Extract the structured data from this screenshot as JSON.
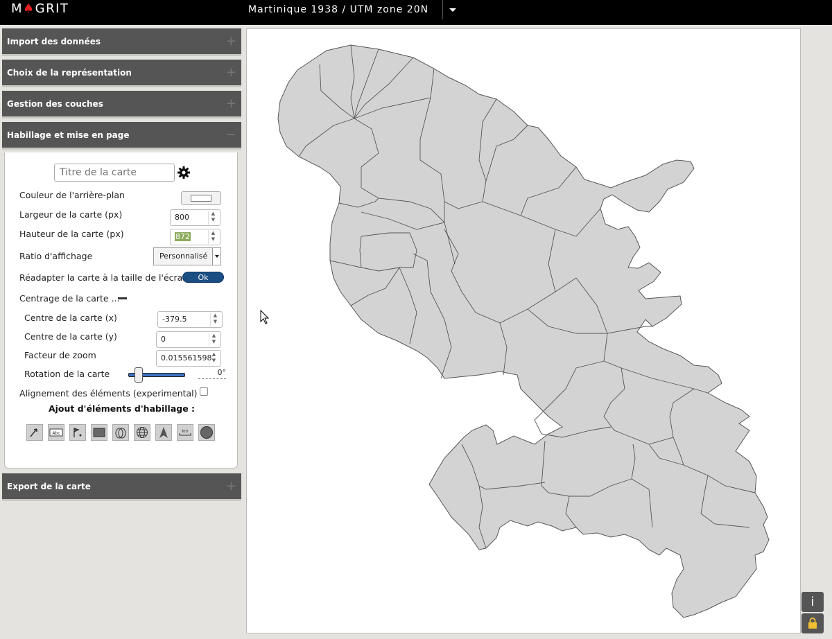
{
  "app": {
    "logo": "MGRIT",
    "projection": "Martinique 1938 / UTM zone 20N"
  },
  "sections": {
    "import": "Import des données",
    "representation": "Choix de la représentation",
    "layers": "Gestion des couches",
    "layout": "Habillage et mise en page",
    "export": "Export de la carte"
  },
  "layout_panel": {
    "title_placeholder": "Titre de la carte",
    "bg_color_label": "Couleur de l'arrière-plan",
    "bg_color": "#ffffff",
    "width_label": "Largeur de la carte (px)",
    "width_value": "800",
    "height_label": "Hauteur de la carte (px)",
    "height_value": "872",
    "ratio_label": "Ratio d'affichage",
    "ratio_value": "Personnalisé",
    "resize_label": "Réadapter la carte à la taille de l'écran",
    "ok_label": "Ok",
    "centering_label": "Centrage de la carte ...",
    "center_x_label": "Centre de la carte (x)",
    "center_x_value": "-379.5",
    "center_y_label": "Centre de la carte (y)",
    "center_y_value": "0",
    "zoom_label": "Facteur de zoom",
    "zoom_value": "0.015561598",
    "rotation_label": "Rotation de la carte",
    "rotation_value": "0°",
    "rotation_level": 0,
    "align_label": "Alignement des éléments (experimental)",
    "align_checked": false,
    "add_elements_title": "Ajout d'éléments d'habillage :",
    "tools": [
      "arrow-tool-icon",
      "text-tool-icon",
      "symbol-tool-icon",
      "rectangle-tool-icon",
      "ellipse-tool-icon",
      "graticule-tool-icon",
      "north-arrow-tool-icon",
      "scale-bar-tool-icon",
      "circle-tool-icon"
    ]
  },
  "corner_buttons": {
    "info": "i"
  },
  "colors": {
    "accent": "#1b4e83",
    "map_fill": "#d3d3d3",
    "map_stroke": "#555555"
  }
}
